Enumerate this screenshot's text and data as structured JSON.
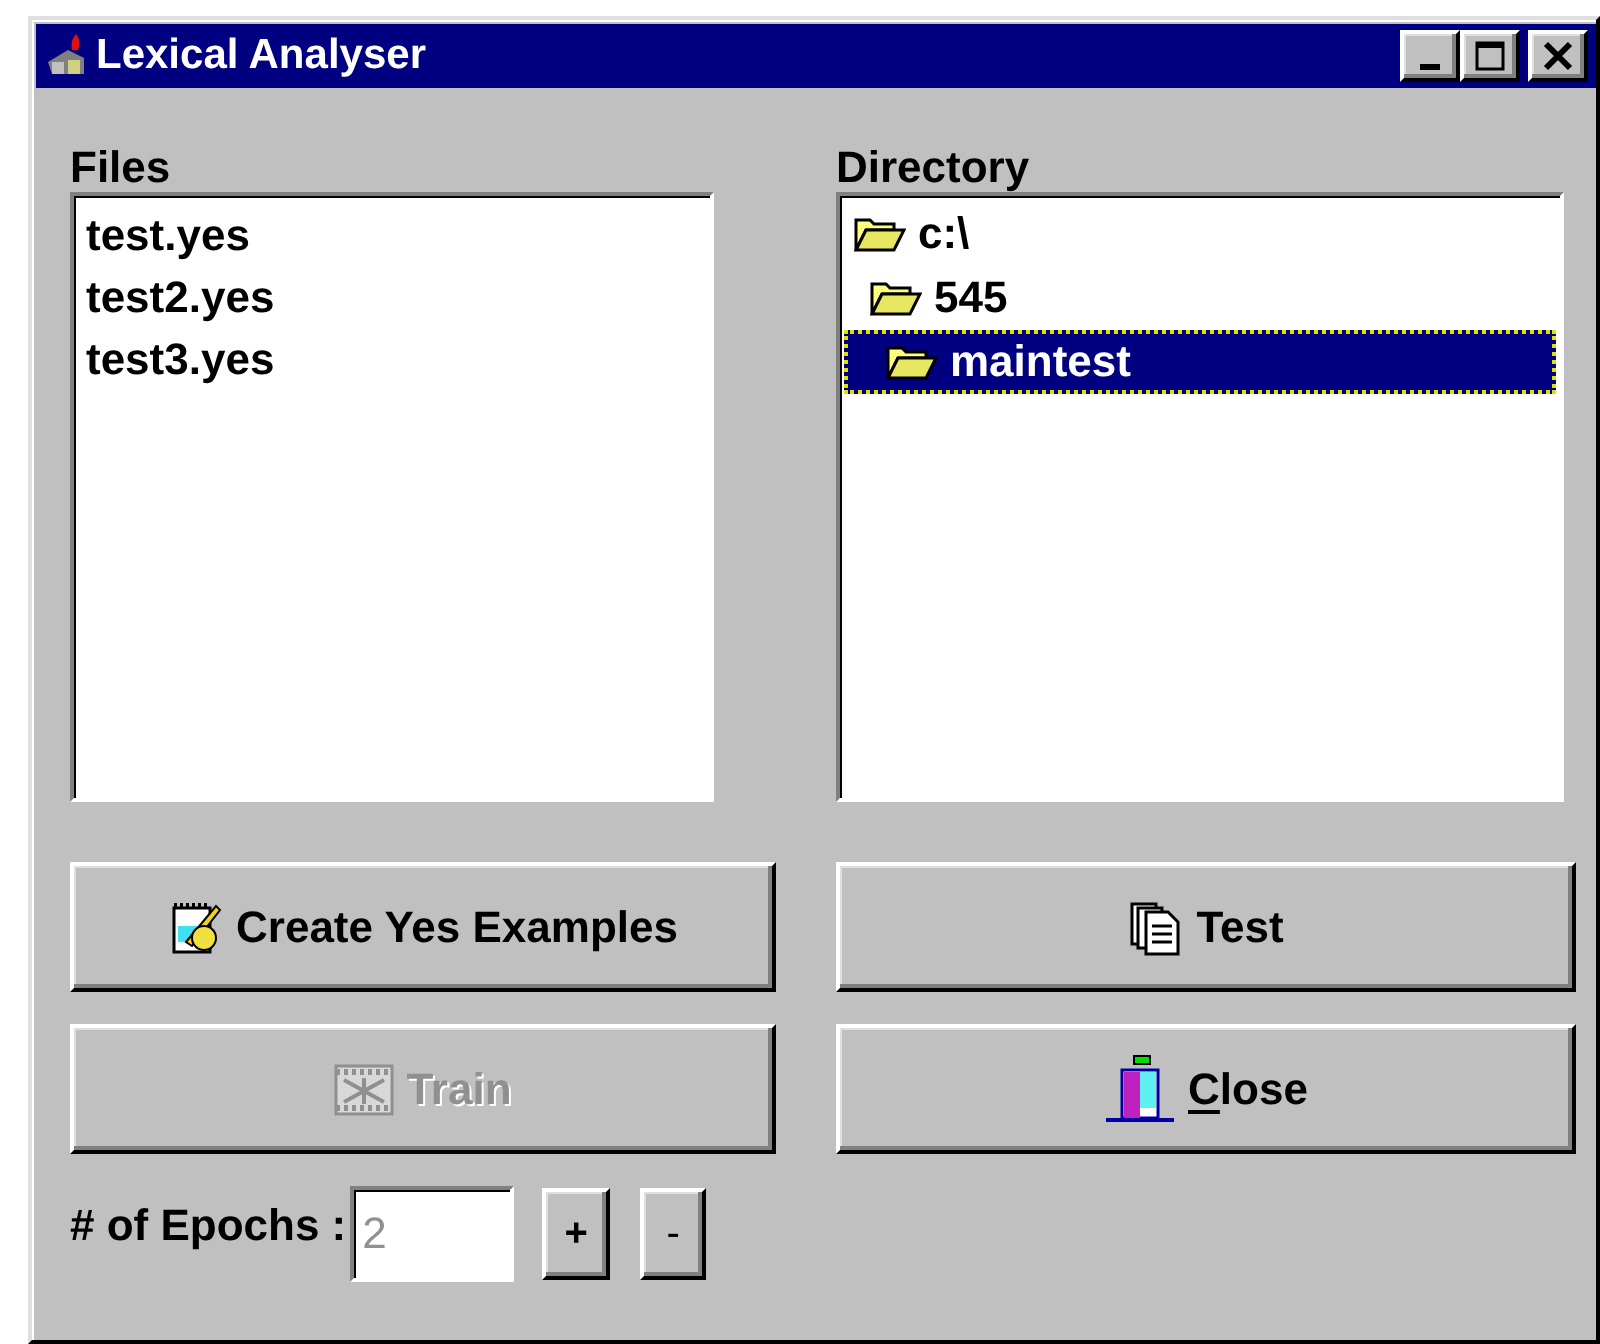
{
  "window": {
    "title": "Lexical Analyser"
  },
  "files": {
    "label": "Files",
    "items": [
      {
        "text": "test.yes",
        "selected": false
      },
      {
        "text": "test2.yes",
        "selected": false
      },
      {
        "text": "test3.yes",
        "selected": false
      }
    ]
  },
  "directory": {
    "label": "Directory",
    "tree": [
      {
        "text": "c:\\",
        "selected": false,
        "children": [
          {
            "text": "545",
            "selected": false,
            "children": [
              {
                "text": "maintest",
                "selected": true
              }
            ]
          }
        ]
      }
    ]
  },
  "buttons": [
    {
      "kind": "notepad",
      "label": "Create Yes Examples",
      "disabled": false
    },
    {
      "kind": "documents",
      "label": "Test",
      "disabled": false
    },
    {
      "kind": "film",
      "label": "Train",
      "disabled": true
    },
    {
      "kind": "door",
      "label": "Close",
      "disabled": false,
      "mnemonic": true
    }
  ],
  "epochs": {
    "label": "# of Epochs :",
    "value": "2",
    "disabled": true,
    "increment": "+",
    "decrement": "-"
  }
}
